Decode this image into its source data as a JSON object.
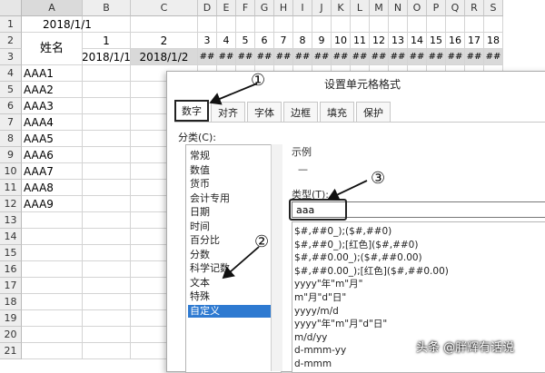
{
  "columns": [
    "A",
    "B",
    "C",
    "D",
    "E",
    "F",
    "G",
    "H",
    "I",
    "J",
    "K",
    "L",
    "M",
    "N",
    "O",
    "P",
    "Q",
    "R",
    "S"
  ],
  "active_column": "A",
  "rows": [
    "1",
    "2",
    "3",
    "4",
    "5",
    "6",
    "7",
    "8",
    "9",
    "10",
    "11",
    "12",
    "13",
    "14",
    "15",
    "16",
    "17",
    "18",
    "19",
    "20",
    "21"
  ],
  "cells": {
    "a1": "2018/1/1",
    "a2_header": "姓名",
    "row2_numbers": [
      "1",
      "2",
      "3",
      "4",
      "5",
      "6",
      "7",
      "8",
      "9",
      "10",
      "11",
      "12",
      "13",
      "14",
      "15",
      "16",
      "17",
      "18"
    ],
    "b3": "2018/1/1",
    "c3": "2018/1/2",
    "hash_fill": "##",
    "names": [
      "AAA1",
      "AAA2",
      "AAA3",
      "AAA4",
      "AAA5",
      "AAA6",
      "AAA7",
      "AAA8",
      "AAA9"
    ]
  },
  "dialog": {
    "title": "设置单元格格式",
    "tabs": [
      "数字",
      "对齐",
      "字体",
      "边框",
      "填充",
      "保护"
    ],
    "active_tab": "数字",
    "category_label": "分类(C):",
    "categories": [
      "常规",
      "数值",
      "货币",
      "会计专用",
      "日期",
      "时间",
      "百分比",
      "分数",
      "科学记数",
      "文本",
      "特殊",
      "自定义"
    ],
    "selected_category": "自定义",
    "sample_label": "示例",
    "sample_value": "—",
    "type_label": "类型(T):",
    "type_value": "aaa",
    "format_codes": [
      "$#,##0_);($#,##0)",
      "$#,##0_);[红色]($#,##0)",
      "$#,##0.00_);($#,##0.00)",
      "$#,##0.00_);[红色]($#,##0.00)",
      "yyyy\"年\"m\"月\"",
      "m\"月\"d\"日\"",
      "yyyy/m/d",
      "yyyy\"年\"m\"月\"d\"日\"",
      "m/d/yy",
      "d-mmm-yy",
      "d-mmm"
    ]
  },
  "annotations": [
    "①",
    "②",
    "③"
  ],
  "watermark": "头条 @胖辉有话说"
}
